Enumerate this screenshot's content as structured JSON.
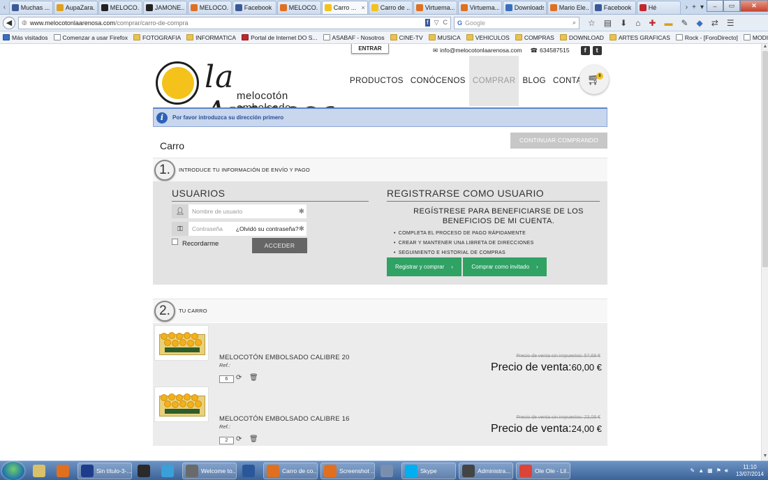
{
  "browser": {
    "tabs": [
      {
        "label": "Muchas ...",
        "color": "#3b5998"
      },
      {
        "label": "AupaZara...",
        "color": "#e0a020"
      },
      {
        "label": "MELOCO...",
        "color": "#222222"
      },
      {
        "label": "JAMONE...",
        "color": "#222222"
      },
      {
        "label": "MELOCO...",
        "color": "#e07020"
      },
      {
        "label": "Facebook",
        "color": "#3b5998"
      },
      {
        "label": "MELOCO...",
        "color": "#e07020"
      },
      {
        "label": "Carro ...",
        "color": "#f4c21a",
        "active": true
      },
      {
        "label": "Carro de ...",
        "color": "#f4c21a"
      },
      {
        "label": "Virtuema...",
        "color": "#e07020"
      },
      {
        "label": "Virtuema...",
        "color": "#e07020"
      },
      {
        "label": "Downloads",
        "color": "#3a6fbf"
      },
      {
        "label": "Mario Ele...",
        "color": "#e07020"
      },
      {
        "label": "Facebook",
        "color": "#3b5998"
      },
      {
        "label": "Hé",
        "color": "#c1272d"
      }
    ],
    "active_tab_close": "×",
    "url_host": "www.melocotonlaarenosa.com",
    "url_path": "/comprar/carro-de-compra",
    "search_engine": "Google",
    "search_placeholder": "Google",
    "bookmarks": [
      {
        "label": "Más visitados",
        "type": "blue"
      },
      {
        "label": "Comenzar a usar Firefox",
        "type": "page"
      },
      {
        "label": "FOTOGRAFIA",
        "type": "folder"
      },
      {
        "label": "INFORMATICA",
        "type": "folder"
      },
      {
        "label": "Portal de Internet DO S...",
        "type": "red"
      },
      {
        "label": "ASABAF - Nosotros",
        "type": "page"
      },
      {
        "label": "CINE-TV",
        "type": "folder"
      },
      {
        "label": "MUSICA",
        "type": "folder"
      },
      {
        "label": "VEHICULOS",
        "type": "folder"
      },
      {
        "label": "COMPRAS",
        "type": "folder"
      },
      {
        "label": "DOWNLOAD",
        "type": "folder"
      },
      {
        "label": "ARTES GRAFICAS",
        "type": "folder"
      },
      {
        "label": "Rock - [ForoDirecto]",
        "type": "page"
      },
      {
        "label": "MODIFICAR PERFIL",
        "type": "page"
      }
    ]
  },
  "site": {
    "login_tab": "ENTRAR",
    "email": "info@melocotonlaarenosa.com",
    "phone": "634587515",
    "logo_word": "la Arenosa",
    "logo_sub": "melocotón embolsado",
    "nav": [
      {
        "label": "PRODUCTOS",
        "selected": false
      },
      {
        "label": "CONÓCENOS",
        "selected": false
      },
      {
        "label": "COMPRAR",
        "selected": true
      },
      {
        "label": "BLOG",
        "selected": false
      },
      {
        "label": "CONTACTO",
        "selected": false
      }
    ],
    "cart_count": "8",
    "alert_message": "Por favor introduzca su dirección primero",
    "page_title": "Carro",
    "continue_button": "CONTINUAR COMPRANDO"
  },
  "step1": {
    "number": "1.",
    "title": "INTRODUCE TU INFORMACIÓN DE ENVÍO Y PAGO",
    "users_heading": "USUARIOS",
    "username_placeholder": "Nombre de usuario",
    "password_placeholder": "Contraseña",
    "forgot": "¿Olvidó su contraseña?",
    "required_mark": "✱",
    "remember": "Recordarme",
    "login_button": "ACCEDER",
    "register_heading": "REGISTRARSE COMO USUARIO",
    "register_intro": "REGÍSTRESE PARA BENEFICIARSE DE LOS BENEFICIOS DE MI CUENTA.",
    "benefits": [
      "COMPLETA EL PROCESO DE PAGO RÁPIDAMENTE",
      "CREAR Y MANTENER UNA LIBRETA DE DIRECCIONES",
      "SEGUIMIENTO E HISTORIAL DE COMPRAS"
    ],
    "register_button": "Registrar y comprar",
    "guest_button": "Comprar como invitado",
    "chevron": "›"
  },
  "step2": {
    "number": "2.",
    "title": "TU CARRO",
    "items": [
      {
        "name": "MELOCOTÓN EMBOLSADO CALIBRE 20",
        "ref": "Ref.:",
        "qty": "6",
        "price_without_tax": "Precio de venta sin impuestos: 57,69 €",
        "price_label": "Precio de venta:",
        "price": "60,00 €"
      },
      {
        "name": "MELOCOTÓN EMBOLSADO CALIBRE 16",
        "ref": "Ref.:",
        "qty": "2",
        "price_without_tax": "Precio de venta sin impuestos: 23,08 €",
        "price_label": "Precio de venta:",
        "price": "24,00 €"
      }
    ]
  },
  "taskbar": {
    "apps": [
      {
        "label": "",
        "color": "#d9c06a"
      },
      {
        "label": "",
        "color": "#e07020"
      },
      {
        "label": "Sin título-3-...",
        "color": "#1f3c8c"
      },
      {
        "label": "",
        "color": "#2a2a2a"
      },
      {
        "label": "",
        "color": "#3aa0d8"
      },
      {
        "label": "Welcome to...",
        "color": "#6a6a6a"
      },
      {
        "label": "",
        "color": "#2b579a"
      },
      {
        "label": "Carro de co...",
        "color": "#e07020"
      },
      {
        "label": "Screenshot ...",
        "color": "#e07020"
      },
      {
        "label": "",
        "color": "#7a8fb0"
      },
      {
        "label": "Skype",
        "color": "#00aff0"
      },
      {
        "label": "Administra...",
        "color": "#444444"
      },
      {
        "label": "Ole Ole - Lil...",
        "color": "#db4437"
      }
    ],
    "time": "11:10",
    "date": "13/07/2014"
  }
}
